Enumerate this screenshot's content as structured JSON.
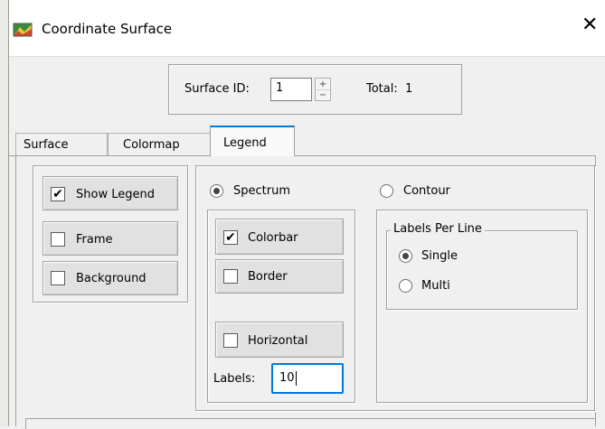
{
  "window": {
    "title": "Coordinate Surface",
    "close_glyph": "✕",
    "app_icon": "colorful-surface-icon"
  },
  "surface_id": {
    "label": "Surface ID:",
    "value": "1",
    "total_label": "Total:",
    "total_value": "1",
    "spin_up": "+",
    "spin_down": "−"
  },
  "tabs": [
    {
      "label": "Surface",
      "active": false
    },
    {
      "label": "Colormap",
      "active": false
    },
    {
      "label": "Legend",
      "active": true
    }
  ],
  "legend_options": {
    "show_legend": {
      "label": "Show Legend",
      "checked": true
    },
    "frame": {
      "label": "Frame",
      "checked": false
    },
    "background": {
      "label": "Background",
      "checked": false
    }
  },
  "mode": {
    "spectrum": {
      "label": "Spectrum",
      "selected": true
    },
    "contour": {
      "label": "Contour",
      "selected": false
    }
  },
  "spectrum_options": {
    "colorbar": {
      "label": "Colorbar",
      "checked": true
    },
    "border": {
      "label": "Border",
      "checked": false
    },
    "horizontal": {
      "label": "Horizontal",
      "checked": false
    },
    "labels_label": "Labels:",
    "labels_value": "10"
  },
  "contour_options": {
    "group_title": "Labels Per Line",
    "single": {
      "label": "Single",
      "selected": true
    },
    "multi": {
      "label": "Multi",
      "selected": false
    }
  },
  "glyphs": {
    "check": "✔"
  }
}
